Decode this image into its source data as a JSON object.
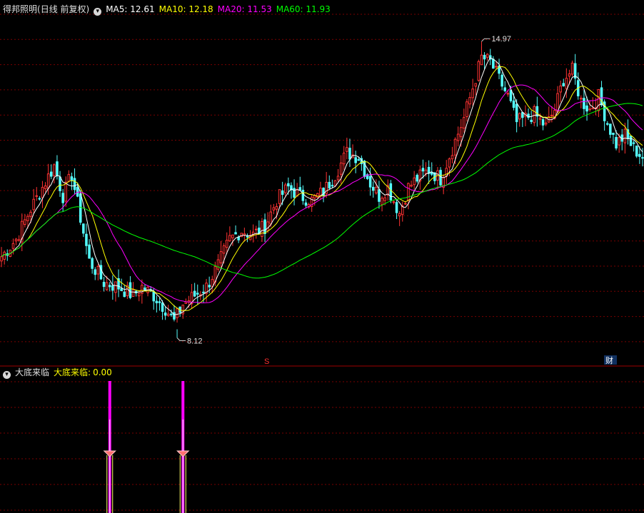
{
  "main_panel": {
    "stock_name": "得邦照明",
    "period": "(日线 前复权)",
    "indicators": [
      {
        "label": "MA5: 12.61",
        "color": "#ffffff"
      },
      {
        "label": "MA10: 12.18",
        "color": "#ffff00"
      },
      {
        "label": "MA20: 11.53",
        "color": "#ff00ff"
      },
      {
        "label": "MA60: 11.93",
        "color": "#00ff00"
      }
    ],
    "high_label": "14.97",
    "low_label": "8.12",
    "marker_s": "S",
    "marker_cai": "财"
  },
  "sub_panel": {
    "indicator_name": "大底来临",
    "value_label": "大底来临:",
    "value": "0.00"
  },
  "colors": {
    "up": "#ff3232",
    "down": "#54ffff",
    "grid": "#7a0000",
    "ma5": "#ffffff",
    "ma10": "#ffff00",
    "ma20": "#ff00ff",
    "ma60": "#00ff00",
    "signal": "#ff00ff"
  },
  "chart_data": {
    "type": "candlestick",
    "price_range": [
      7.6,
      15.6
    ],
    "high": 14.97,
    "low": 8.12,
    "anchors": [
      [
        0,
        10.0
      ],
      [
        5,
        10.4
      ],
      [
        10,
        11.1
      ],
      [
        14,
        11.6
      ],
      [
        18,
        12.1
      ],
      [
        21,
        11.4
      ],
      [
        24,
        11.9
      ],
      [
        27,
        10.9
      ],
      [
        30,
        9.9
      ],
      [
        35,
        9.4
      ],
      [
        40,
        9.3
      ],
      [
        45,
        9.1
      ],
      [
        48,
        9.3
      ],
      [
        52,
        9.1
      ],
      [
        56,
        8.8
      ],
      [
        59,
        8.5
      ],
      [
        62,
        8.9
      ],
      [
        66,
        9.1
      ],
      [
        70,
        9.3
      ],
      [
        74,
        9.8
      ],
      [
        78,
        10.4
      ],
      [
        82,
        10.6
      ],
      [
        86,
        10.5
      ],
      [
        90,
        10.7
      ],
      [
        94,
        11.3
      ],
      [
        98,
        11.6
      ],
      [
        102,
        11.4
      ],
      [
        106,
        11.3
      ],
      [
        110,
        11.5
      ],
      [
        114,
        11.9
      ],
      [
        118,
        12.4
      ],
      [
        122,
        12.3
      ],
      [
        126,
        11.7
      ],
      [
        129,
        11.4
      ],
      [
        132,
        11.6
      ],
      [
        136,
        11.0
      ],
      [
        139,
        11.6
      ],
      [
        142,
        11.8
      ],
      [
        146,
        12.0
      ],
      [
        150,
        11.8
      ],
      [
        154,
        12.5
      ],
      [
        158,
        13.2
      ],
      [
        161,
        13.9
      ],
      [
        164,
        14.6
      ],
      [
        167,
        14.5
      ],
      [
        170,
        14.1
      ],
      [
        173,
        13.7
      ],
      [
        176,
        13.1
      ],
      [
        179,
        13.2
      ],
      [
        182,
        13.3
      ],
      [
        186,
        13.0
      ],
      [
        189,
        13.4
      ],
      [
        192,
        14.1
      ],
      [
        195,
        14.3
      ],
      [
        198,
        13.6
      ],
      [
        201,
        13.4
      ],
      [
        204,
        13.7
      ],
      [
        207,
        13.1
      ],
      [
        210,
        12.6
      ],
      [
        213,
        12.8
      ],
      [
        216,
        12.5
      ],
      [
        219,
        12.3
      ]
    ],
    "ma_periods": [
      5,
      10,
      20,
      60
    ],
    "signals": [
      37,
      62
    ]
  }
}
